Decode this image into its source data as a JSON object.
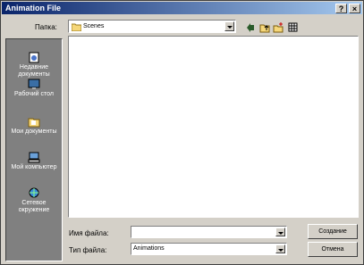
{
  "window": {
    "title": "Animation File",
    "help_btn": "?",
    "close_btn": "×"
  },
  "lookin": {
    "label": "Папка:",
    "value": "Scenes"
  },
  "places": [
    {
      "label": "Недавние документы",
      "icon": "recent-docs-icon"
    },
    {
      "label": "Рабочий стол",
      "icon": "desktop-icon"
    },
    {
      "label": "Мои документы",
      "icon": "my-documents-icon"
    },
    {
      "label": "Мой компьютер",
      "icon": "my-computer-icon"
    },
    {
      "label": "Сетевое окружение",
      "icon": "network-icon"
    }
  ],
  "filename": {
    "label": "Имя файла:",
    "value": ""
  },
  "filetype": {
    "label": "Тип файла:",
    "value": "Animations"
  },
  "buttons": {
    "ok": "Создание",
    "cancel": "Отмена"
  },
  "colors": {
    "title_start": "#0a246a",
    "title_end": "#a6caf0",
    "face": "#d4d0c8",
    "places_bg": "#808080"
  }
}
